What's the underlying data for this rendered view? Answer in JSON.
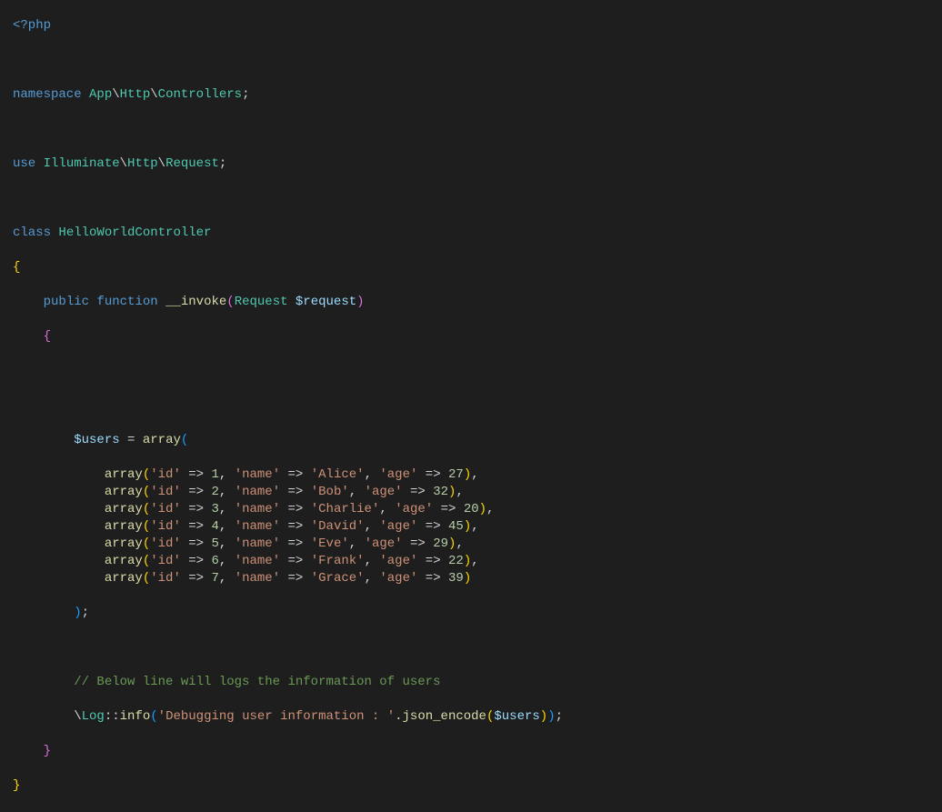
{
  "code": {
    "php_open": "<?php",
    "namespace_kw": "namespace",
    "namespace_path1": "App",
    "namespace_path2": "Http",
    "namespace_path3": "Controllers",
    "use_kw": "use",
    "use_path1": "Illuminate",
    "use_path2": "Http",
    "use_path3": "Request",
    "class_kw": "class",
    "class_name": "HelloWorldController",
    "public_kw": "public",
    "function_kw": "function",
    "func_name": "__invoke",
    "param_type": "Request",
    "param_var": "$request",
    "users_var": "$users",
    "array_fn": "array",
    "users": [
      {
        "id": 1,
        "name": "Alice",
        "age": 27
      },
      {
        "id": 2,
        "name": "Bob",
        "age": 32
      },
      {
        "id": 3,
        "name": "Charlie",
        "age": 20
      },
      {
        "id": 4,
        "name": "David",
        "age": 45
      },
      {
        "id": 5,
        "name": "Eve",
        "age": 29
      },
      {
        "id": 6,
        "name": "Frank",
        "age": 22
      },
      {
        "id": 7,
        "name": "Grace",
        "age": 39
      }
    ],
    "key_id": "'id'",
    "key_name": "'name'",
    "key_age": "'age'",
    "comment": "// Below line will logs the information of users",
    "log_class": "Log",
    "log_method": "info",
    "log_string": "'Debugging user information : '",
    "json_encode": "json_encode",
    "semicolon": ";",
    "backslash": "\\",
    "dot": ".",
    "assign": "=",
    "arrow": "=>",
    "comma": ",",
    "paren_open": "(",
    "paren_close": ")",
    "brace_open": "{",
    "brace_close": "}",
    "scope": "::"
  }
}
